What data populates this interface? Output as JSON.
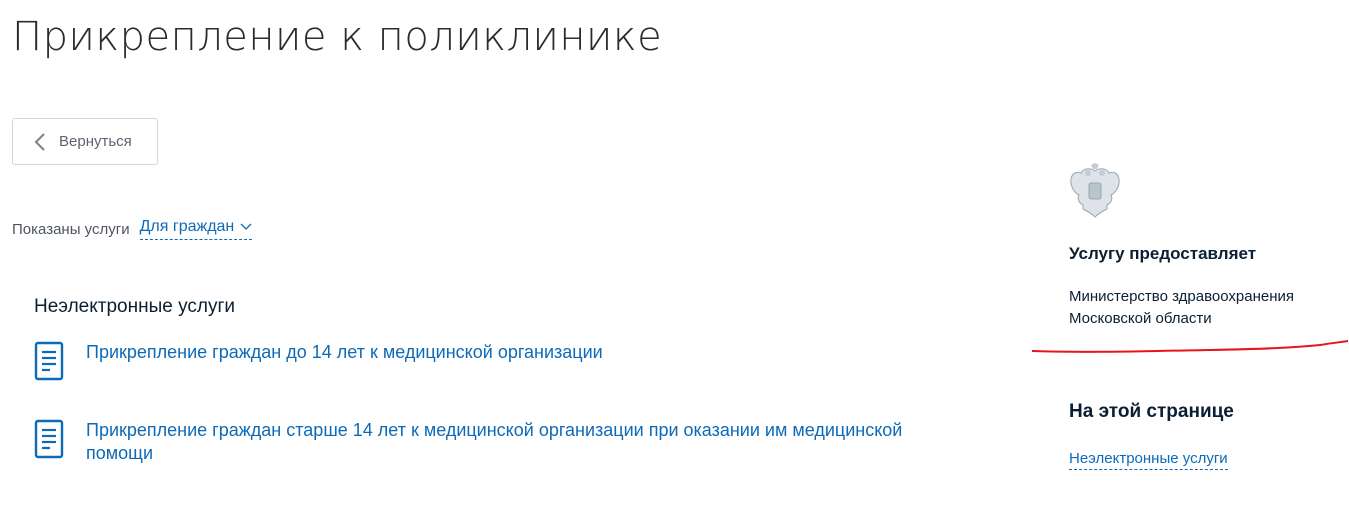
{
  "page": {
    "title": "Прикрепление к поликлинике"
  },
  "back_button": {
    "label": "Вернуться"
  },
  "filter": {
    "label": "Показаны услуги",
    "selected": "Для граждан"
  },
  "services": {
    "section_title": "Неэлектронные услуги",
    "items": [
      {
        "label": "Прикрепление граждан до 14 лет к медицинской организации"
      },
      {
        "label": "Прикрепление граждан старше 14 лет к медицинской организации при оказании им медицинской помощи"
      }
    ]
  },
  "sidebar": {
    "provider_heading": "Услугу предоставляет",
    "provider_name": "Министерство здравоохранения Московской области",
    "onpage_heading": "На этой странице",
    "onpage_links": [
      {
        "label": "Неэлектронные услуги"
      }
    ]
  },
  "colors": {
    "link": "#0d6ab8",
    "text": "#0b1f33",
    "annotation": "#e8141b"
  },
  "icons": {
    "back": "chevron-left-icon",
    "dropdown": "chevron-down-icon",
    "service": "document-icon",
    "emblem": "coat-of-arms-icon"
  }
}
